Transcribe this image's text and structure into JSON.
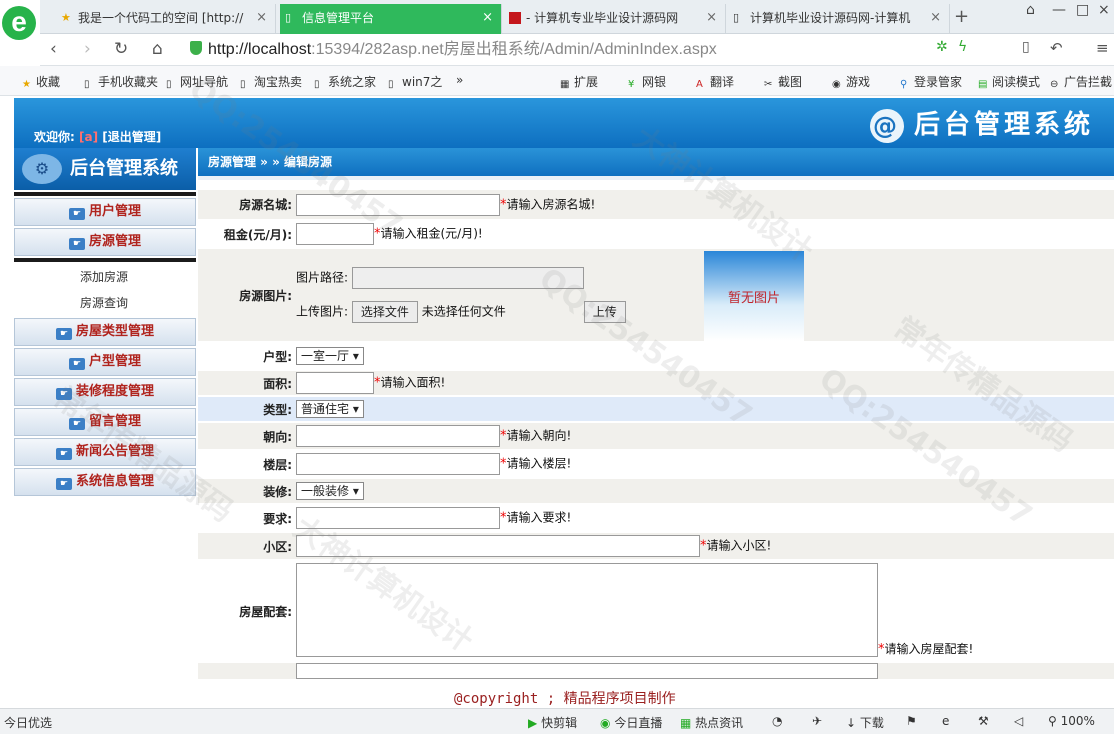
{
  "browser": {
    "tabs": [
      {
        "label": "我是一个代码工的空间 [http://",
        "icon": "star-icon"
      },
      {
        "label": "信息管理平台",
        "icon": "page-icon",
        "active": true
      },
      {
        "label": "- 计算机专业毕业设计源码网",
        "icon": "red-square-icon"
      },
      {
        "label": "计算机毕业设计源码网-计算机",
        "icon": "page-icon"
      }
    ],
    "new_tab": "+",
    "url_host": "http://localhost",
    "url_rest": ":15394/282asp.net房屋出租系统/Admin/AdminIndex.aspx",
    "bookmarks": [
      "收藏",
      "手机收藏夹",
      "网址导航",
      "淘宝热卖",
      "系统之家",
      "win7之",
      "扩展",
      "网银",
      "翻译",
      "截图",
      "游戏",
      "登录管家",
      "阅读模式",
      "广告拦截"
    ]
  },
  "header": {
    "welcome": "欢迎你:",
    "user": "[a]",
    "logout": "[退出管理]",
    "brand": "后台管理系统",
    "logo_char": "@"
  },
  "sidebar": {
    "title": "后台管理系统",
    "items": [
      "用户管理",
      "房源管理"
    ],
    "sub_items": [
      "添加房源",
      "房源查询"
    ],
    "more_items": [
      "房屋类型管理",
      "户型管理",
      "装修程度管理",
      "留言管理",
      "新闻公告管理",
      "系统信息管理"
    ]
  },
  "breadcrumb": "房源管理 » » 编辑房源",
  "form": {
    "name_label": "房源名城:",
    "name_hint": "请输入房源名城!",
    "rent_label": "租金(元/月):",
    "rent_hint": "请输入租金(元/月)!",
    "image_label": "房源图片:",
    "image_path_label": "图片路径:",
    "upload_label": "上传图片:",
    "choose_file": "选择文件",
    "no_file": "未选择任何文件",
    "upload_btn": "上传",
    "no_image": "暂无图片",
    "layout_label": "户型:",
    "layout_value": "一室一厅",
    "area_label": "面积:",
    "area_hint": "请输入面积!",
    "type_label": "类型:",
    "type_value": "普通住宅",
    "orient_label": "朝向:",
    "orient_hint": "请输入朝向!",
    "floor_label": "楼层:",
    "floor_hint": "请输入楼层!",
    "decor_label": "装修:",
    "decor_value": "一般装修",
    "req_label": "要求:",
    "req_hint": "请输入要求!",
    "community_label": "小区:",
    "community_hint": "请输入小区!",
    "facility_label": "房屋配套:",
    "facility_hint": "请输入房屋配套!"
  },
  "footer": "@copyright ; 精品程序项目制作",
  "statusbar": {
    "left": "今日优选",
    "items": [
      "快剪辑",
      "今日直播",
      "热点资讯",
      "下载"
    ],
    "zoom": "100%"
  },
  "watermarks": [
    "QQ:254540457",
    "常年传精品源码",
    "大神计算机设计"
  ]
}
